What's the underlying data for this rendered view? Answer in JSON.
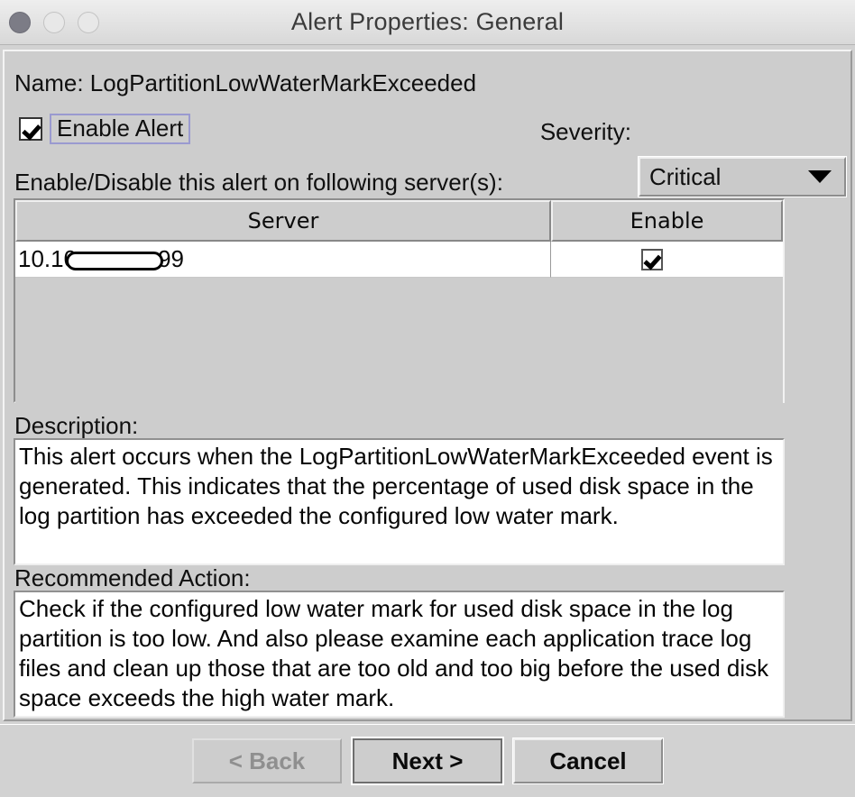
{
  "window": {
    "title": "Alert Properties: General",
    "traffic_lights": [
      "close-button",
      "minimize-button",
      "zoom-button"
    ]
  },
  "form": {
    "name_label": "Name:",
    "name_value": "LogPartitionLowWaterMarkExceeded",
    "name_line": "Name: LogPartitionLowWaterMarkExceeded",
    "enable_alert": {
      "label": "Enable Alert",
      "checked": true,
      "checkmark": "✔"
    },
    "severity": {
      "label": "Severity:",
      "value": "Critical",
      "options": [
        "Critical"
      ],
      "caret": "▼"
    }
  },
  "server_section": {
    "caption": "Enable/Disable this alert on following server(s):",
    "columns": [
      "Server",
      "Enable"
    ],
    "rows": [
      {
        "server_prefix": "10.10",
        "server_redacted": true,
        "server_suffix": "99",
        "enabled": true
      }
    ]
  },
  "description": {
    "label": "Description:",
    "text": "This alert occurs when the LogPartitionLowWaterMarkExceeded event is generated. This indicates that the percentage of used disk space in the log partition has exceeded the configured low water mark."
  },
  "recommended_action": {
    "label": "Recommended Action:",
    "text": "Check if the configured low water mark for used disk space in the log partition is too low. And also please examine each application trace log files and clean up those that are too old and too big before the used disk space exceeds the high water mark."
  },
  "buttons": {
    "back": "< Back",
    "next": "Next >",
    "cancel": "Cancel"
  },
  "colors": {
    "dialog_background": "#d2d2d2",
    "panel_background": "#cdcdcd",
    "titlebar_background": "#e6e6e6",
    "field_background": "#ffffff",
    "text": "#101010",
    "disabled_text": "#8f8f8f",
    "focus_ring": "#9a9ad0",
    "close_light": "#7c7c86",
    "inactive_light": "#e8e8e8"
  }
}
